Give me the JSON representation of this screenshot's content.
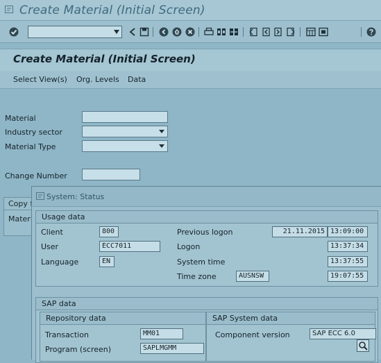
{
  "window": {
    "title": "Create Material (Initial Screen)"
  },
  "toolbar": {
    "icons": [
      "enter-icon",
      "back-icon",
      "save-icon",
      "back-green-icon",
      "exit-icon",
      "cancel-icon",
      "print-icon",
      "find-icon",
      "find-next-icon",
      "first-page-icon",
      "previous-page-icon",
      "next-page-icon",
      "last-page-icon",
      "new-session-icon",
      "shortcut-icon",
      "help-icon"
    ]
  },
  "screen": {
    "title": "Create Material (Initial Screen)"
  },
  "menu": {
    "items": [
      "Select View(s)",
      "Org. Levels",
      "Data"
    ]
  },
  "form": {
    "material_label": "Material",
    "industry_label": "Industry sector",
    "type_label": "Material Type",
    "change_label": "Change Number",
    "copy_label": "Copy f",
    "copy_material_label": "Materi"
  },
  "dialog": {
    "title": "System: Status",
    "usage": {
      "header": "Usage data",
      "client_label": "Client",
      "client": "800",
      "user_label": "User",
      "user": "ECC7011",
      "language_label": "Language",
      "language": "EN",
      "prev_logon_label": "Previous logon",
      "prev_logon_date": "21.11.2015",
      "prev_logon_time": "13:09:00",
      "logon_label": "Logon",
      "logon_time": "13:37:34",
      "system_time_label": "System time",
      "system_time": "13:37:55",
      "time_zone_label": "Time zone",
      "time_zone": "AUSNSW",
      "time_zone_time": "19:07:55"
    },
    "sap": {
      "header": "SAP data",
      "repo_header": "Repository data",
      "transaction_label": "Transaction",
      "transaction": "MM01",
      "program_label": "Program (screen)",
      "program": "SAPLMGMM",
      "sys_header": "SAP System data",
      "component_label": "Component version",
      "component": "SAP ECC 6.0"
    }
  }
}
